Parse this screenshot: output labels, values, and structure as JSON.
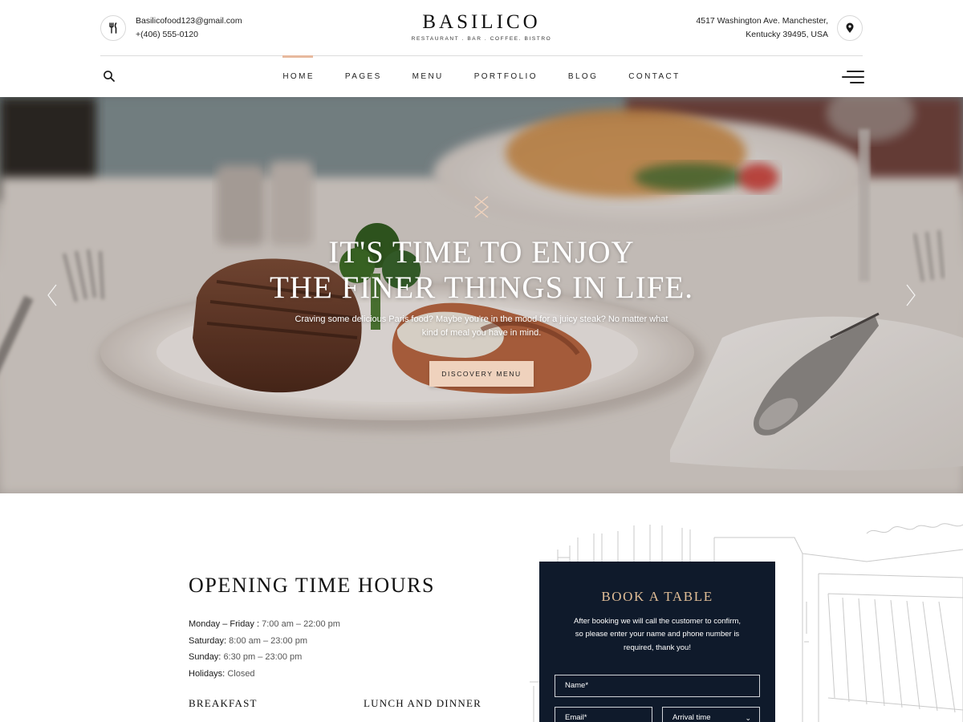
{
  "header": {
    "email": "Basilicofood123@gmail.com",
    "phone": "+(406) 555-0120",
    "brand_name": "BASILICO",
    "brand_tagline": "RESTAURANT . BAR . COFFEE. BISTRO",
    "address_line1": "4517 Washington Ave. Manchester,",
    "address_line2": "Kentucky 39495, USA",
    "left_icon": "fork-knife-icon",
    "right_icon": "map-pin-icon"
  },
  "nav": {
    "items": [
      {
        "label": "HOME",
        "active": true
      },
      {
        "label": "PAGES"
      },
      {
        "label": "MENU"
      },
      {
        "label": "PORTFOLIO"
      },
      {
        "label": "BLOG"
      },
      {
        "label": "CONTACT"
      }
    ],
    "search_icon": "search-icon",
    "menu_icon": "hamburger-icon",
    "active_color": "#e7b99e"
  },
  "hero": {
    "title_line1": "IT'S TIME TO ENJOY",
    "title_line2": "THE FINER THINGS IN LIFE.",
    "subtitle_line1": "Craving some delicious Paris food? Maybe you're in the mood for a juicy steak? No matter what",
    "subtitle_line2": "kind of meal you have in mind.",
    "button_label": "DISCOVERY MENU",
    "button_color": "#efd2bd"
  },
  "hours": {
    "title": "OPENING TIME HOURS",
    "rows": [
      {
        "label": "Monday – Friday :",
        "value": "7:00 am – 22:00 pm"
      },
      {
        "label": "Saturday:",
        "value": "8:00 am – 23:00 pm"
      },
      {
        "label": "Sunday:",
        "value": "6:30 pm – 23:00 pm"
      },
      {
        "label": "Holidays:",
        "value": "Closed"
      }
    ],
    "breakfast": "BREAKFAST",
    "lunch_dinner": "LUNCH AND DINNER"
  },
  "booking": {
    "title": "BOOK A TABLE",
    "desc_line1": "After booking we will call the customer to confirm,",
    "desc_line2": "so please enter your name and phone number is",
    "desc_line3": "required, thank you!",
    "name_placeholder": "Name*",
    "email_placeholder": "Email*",
    "arrival_placeholder": "Arrival time",
    "bg_color": "#0f1a2b",
    "title_color": "#e0bd96"
  }
}
